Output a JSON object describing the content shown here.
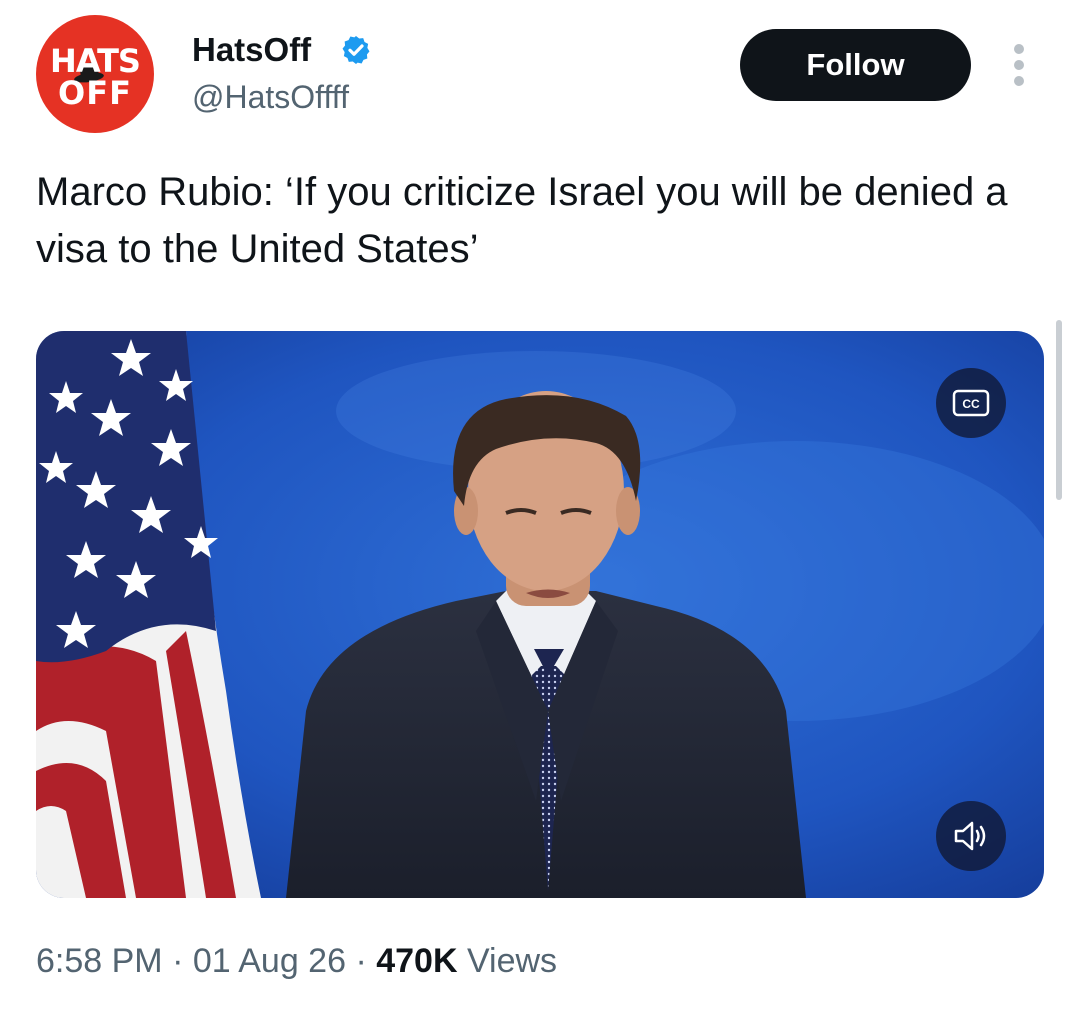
{
  "author": {
    "avatar_line1": "HATS",
    "avatar_line2": "OFF",
    "display_name": "HatsOff",
    "handle": "@HatsOffff"
  },
  "actions": {
    "follow_label": "Follow"
  },
  "tweet": {
    "text": "Marco Rubio: ‘If you criticize Israel you will be denied a visa to the United States’"
  },
  "media": {
    "cc_label": "CC"
  },
  "meta": {
    "time": "6:58 PM",
    "date": "01 Aug 26",
    "separator": " · ",
    "views_count": "470K",
    "views_label": "Views"
  },
  "colors": {
    "avatar_red": "#e53224",
    "verified_blue": "#1d9bf0",
    "follow_bg": "#0f1419",
    "secondary_text": "#536471"
  },
  "icons": [
    "verified-badge-icon",
    "more-options-icon",
    "cc-icon",
    "volume-icon"
  ]
}
